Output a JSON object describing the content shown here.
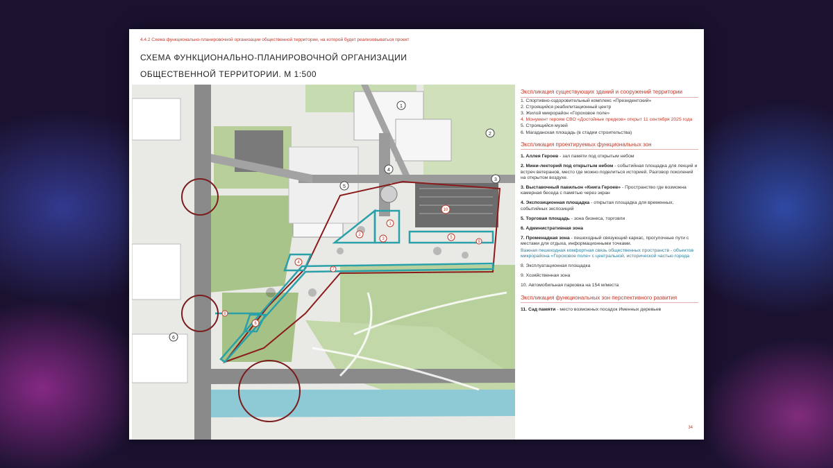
{
  "slide": {
    "pre_title": "4.4.2 Схема функционально-планировочной организации общественной территории, на которой будет реализовываться проект",
    "title_line1": "СХЕМА ФУНКЦИОНАЛЬНО-ПЛАНИРОВОЧНОЙ ОРГАНИЗАЦИИ",
    "title_line2": "ОБЩЕСТВЕННОЙ ТЕРРИТОРИИ. М 1:500",
    "page_number": "34"
  },
  "map_labels": {
    "b1": "1",
    "b2": "2",
    "b3": "3",
    "b4": "4",
    "b5": "5",
    "b6": "6",
    "z1": "1",
    "z2": "2",
    "z3": "3",
    "z4": "4",
    "z5": "5",
    "z6": "6",
    "z7": "7",
    "z8": "8",
    "z9": "9",
    "z10": "10"
  },
  "legend": {
    "existing_title": "Экспликация существующих зданий и сооружений территории",
    "existing": [
      "1. Спортивно-оздоровительный комплекс «Президентский»",
      "2. Строящийся реабилитационный центр",
      "3. Жилой микрорайон «Гороховое поле»",
      "5. Строящийся музей",
      "6. Магаданская площадь (в стадии строительства)"
    ],
    "existing_red": "4. Монумент героям СВО «Достойные предков» открыт 11 сентября 2025 года",
    "projected_title": "Экспликация проектируемых функциональных зон",
    "p1_name": "1. Аллея Героев",
    "p1_desc": " - зал памяти под открытым небом",
    "p2_name": "2. Мини-лекторий под открытым небом",
    "p2_desc": " - событийная площадка для лекций и встреч ветеранов, место где можно поделиться историей. Разговор поколений на открытом воздухе.",
    "p3_name": "3. Выставочный павильон «Книга Героев»",
    "p3_desc": " - Пространство где возможна камерная беседа с памятью через экран",
    "p4_name": "4. Экспозиционная площадка",
    "p4_desc": " - открытая площадка для временных, событийных экспозиций",
    "p5_name": "5. Торговая площадь",
    "p5_desc": " - зона бизнеса, торговли",
    "p6_name": "6. Административная зона",
    "p7_name": "7. Променадная зона",
    "p7_desc": " - пешеходный связующий каркас, прогулочные пути с местами для отдыха, информационными точками.",
    "p7_blue": "Важная пешеходная комфортная связь общественных пространств - объектов микрорайона «Гороховое поле» с центральной, исторической частью города",
    "p8": "8. Эксплуатационная площадка",
    "p9": "9. Хозяйственная зона",
    "p10": "10. Автомобильная парковка на 154 м/места",
    "future_title": "Экспликация функциональных зон перспективного развития",
    "f11_name": "11. Сад памяти",
    "f11_desc": " - место возможных посадок Именных деревьев"
  },
  "colors": {
    "accent_red": "#c0392b",
    "zone_teal": "#2aa0a8",
    "boundary_red": "#8b1a1a",
    "road_gray": "#8a8a8a",
    "green": "#a8c48a",
    "river": "#8ec9d6"
  }
}
